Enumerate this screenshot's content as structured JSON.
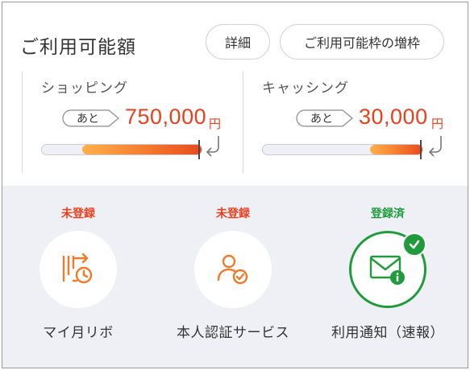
{
  "header": {
    "title": "ご利用可能額",
    "detail_label": "詳細",
    "increase_label": "ご利用可能枠の増枠"
  },
  "shopping": {
    "label": "ショッピング",
    "remaining_prefix": "あと",
    "amount": "750,000",
    "unit": "円",
    "bar_fill_fraction": 0.75
  },
  "cashing": {
    "label": "キャッシング",
    "remaining_prefix": "あと",
    "amount": "30,000",
    "unit": "円",
    "bar_fill_fraction": 0.33
  },
  "services": [
    {
      "status": "未登録",
      "label": "マイ月リボ",
      "registered": false,
      "icon": "revolving-calendar-icon"
    },
    {
      "status": "未登録",
      "label": "本人認証サービス",
      "registered": false,
      "icon": "user-verified-icon"
    },
    {
      "status": "登録済",
      "label": "利用通知（速報）",
      "registered": true,
      "icon": "mail-info-icon"
    }
  ],
  "colors": {
    "accent": "#e8401c",
    "unregistered": "#e8401c",
    "registered": "#1f9b3c",
    "icon_orange": "#f07a2a"
  }
}
